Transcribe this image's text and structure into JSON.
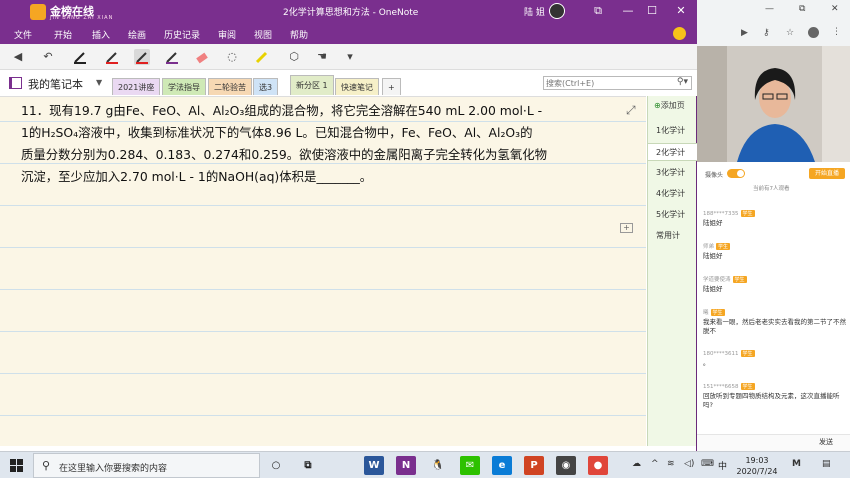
{
  "onenote": {
    "title": "2化学计算思想和方法 - OneNote",
    "user_name": "陆 姐",
    "logo": {
      "main": "金榜在线",
      "sub": "JIN BANG ZAI XIAN"
    },
    "window_controls": {
      "restore_icon": "restore-icon",
      "minimize": "—",
      "maximize": "☐",
      "close": "✕"
    },
    "menu": [
      "文件",
      "开始",
      "插入",
      "绘画",
      "历史记录",
      "审阅",
      "视图",
      "帮助"
    ],
    "toolbar_icons": [
      "back-icon",
      "undo-icon",
      "pen-black-icon",
      "pen-red-icon",
      "pen-purple-icon",
      "eraser-icon",
      "lasso-icon",
      "highlighter-icon",
      "shapes-icon",
      "touch-icon",
      "more-icon"
    ],
    "notebook_name": "我的笔记本",
    "sections": [
      {
        "label": "2021讲座",
        "color": "#ead9f2"
      },
      {
        "label": "学法指导",
        "color": "#cfe9b6"
      },
      {
        "label": "二轮验苦",
        "color": "#f6d8b3"
      },
      {
        "label": "选3",
        "color": "#cfe3f6"
      },
      {
        "label": "新分区 1",
        "color": "#e1ecc8"
      },
      {
        "label": "快速笔记",
        "color": "#f6f0c8"
      }
    ],
    "add_section": "+",
    "search_placeholder": "搜索(Ctrl+E)",
    "page_content": {
      "line1": "11．现有19.7 g由Fe、FeO、Al、Al₂O₃组成的混合物，将它完全溶解在540 mL 2.00 mol·L -",
      "line2": "1的H₂SO₄溶液中，收集到标准状况下的气体8.96 L。已知混合物中，Fe、FeO、Al、Al₂O₃的",
      "line3": "质量分数分别为0.284、0.183、0.274和0.259。欲使溶液中的金属阳离子完全转化为氢氧化物",
      "line4": "沉淀，至少应加入2.70 mol·L - 1的NaOH(aq)体积是_______。"
    },
    "add_page": "添加页",
    "pages": [
      "1化学计",
      "2化学计",
      "3化学计",
      "4化学计",
      "5化学计",
      "常用计"
    ],
    "selected_page_index": 1
  },
  "side_panel": {
    "video_controls": {
      "camera_label": "摄像头",
      "start_label": "开始直播",
      "viewers": "当前有7人观看"
    },
    "chat": [
      {
        "user": "188****7335",
        "badge": "学生",
        "text": "陆姐好"
      },
      {
        "user": "师弟",
        "badge": "学生",
        "text": "陆姐好"
      },
      {
        "user": "学道要使涛",
        "badge": "学生",
        "text": "陆姐好"
      },
      {
        "user": "曦",
        "badge": "学生",
        "text": "我来看一眼，然后老老实实去看我的第二节了不然脱不"
      },
      {
        "user": "180****3611",
        "badge": "学生",
        "text": "。"
      },
      {
        "user": "151****6658",
        "badge": "学生",
        "text": "回放听到专题四物质结构及元素，这次直播能听吗?"
      }
    ],
    "send_label": "发送"
  },
  "taskbar": {
    "search_text": "在这里输入你要搜索的内容",
    "apps": [
      {
        "icon": "cortana-icon",
        "color": "#dfe6ee",
        "glyph": "○"
      },
      {
        "icon": "task-view-icon",
        "color": "#dfe6ee",
        "glyph": "⧉"
      },
      {
        "icon": "word-icon",
        "color": "#2b579a",
        "glyph": "W"
      },
      {
        "icon": "onenote-icon",
        "color": "#7a2f8e",
        "glyph": "N"
      },
      {
        "icon": "qq-icon",
        "color": "#dfe6ee",
        "glyph": "🐧"
      },
      {
        "icon": "wechat-icon",
        "color": "#2dc100",
        "glyph": "✉"
      },
      {
        "icon": "edge-icon",
        "color": "#0a7cd6",
        "glyph": "e"
      },
      {
        "icon": "powerpoint-icon",
        "color": "#d04423",
        "glyph": "P"
      },
      {
        "icon": "media-icon",
        "color": "#444444",
        "glyph": "◉"
      },
      {
        "icon": "chrome-icon",
        "color": "#e0463a",
        "glyph": "●"
      }
    ],
    "ime": "中",
    "time": "19:03",
    "date": "2020/7/24"
  }
}
